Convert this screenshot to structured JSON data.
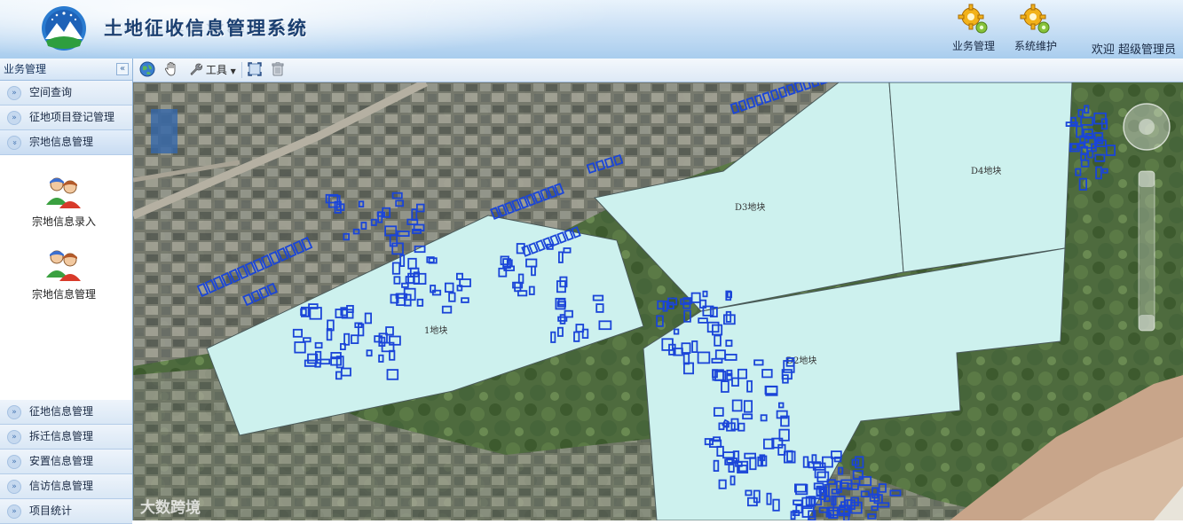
{
  "app": {
    "title": "土地征收信息管理系统",
    "welcome": "欢迎 超级管理员",
    "top_buttons": [
      {
        "label": "业务管理",
        "icon": "gear-icon"
      },
      {
        "label": "系统维护",
        "icon": "gear-icon"
      }
    ]
  },
  "sidebar": {
    "header": "业务管理",
    "collapse_icon": "«",
    "items_top": [
      {
        "label": "空间查询"
      },
      {
        "label": "征地项目登记管理"
      },
      {
        "label": "宗地信息管理"
      }
    ],
    "sub_items": [
      {
        "label": "宗地信息录入",
        "icon": "users-icon"
      },
      {
        "label": "宗地信息管理",
        "icon": "users-icon"
      }
    ],
    "items_bottom": [
      {
        "label": "征地信息管理"
      },
      {
        "label": "拆迁信息管理"
      },
      {
        "label": "安置信息管理"
      },
      {
        "label": "信访信息管理"
      },
      {
        "label": "项目统计"
      }
    ]
  },
  "toolbar": {
    "tools_label": "工具",
    "icons": [
      "globe-icon",
      "pan-hand-icon",
      "wrench-icon",
      "full-extent-icon",
      "trash-icon"
    ]
  },
  "map": {
    "parcels": [
      {
        "label": "1地块"
      },
      {
        "label": "D2地块"
      },
      {
        "label": "D3地块"
      },
      {
        "label": "D4地块"
      }
    ],
    "colors": {
      "parcel_fill": "#cdf1ee",
      "parcel_outline": "#4a5a5a",
      "building_outline": "#1a45d8"
    }
  },
  "watermark": "大数跨境"
}
